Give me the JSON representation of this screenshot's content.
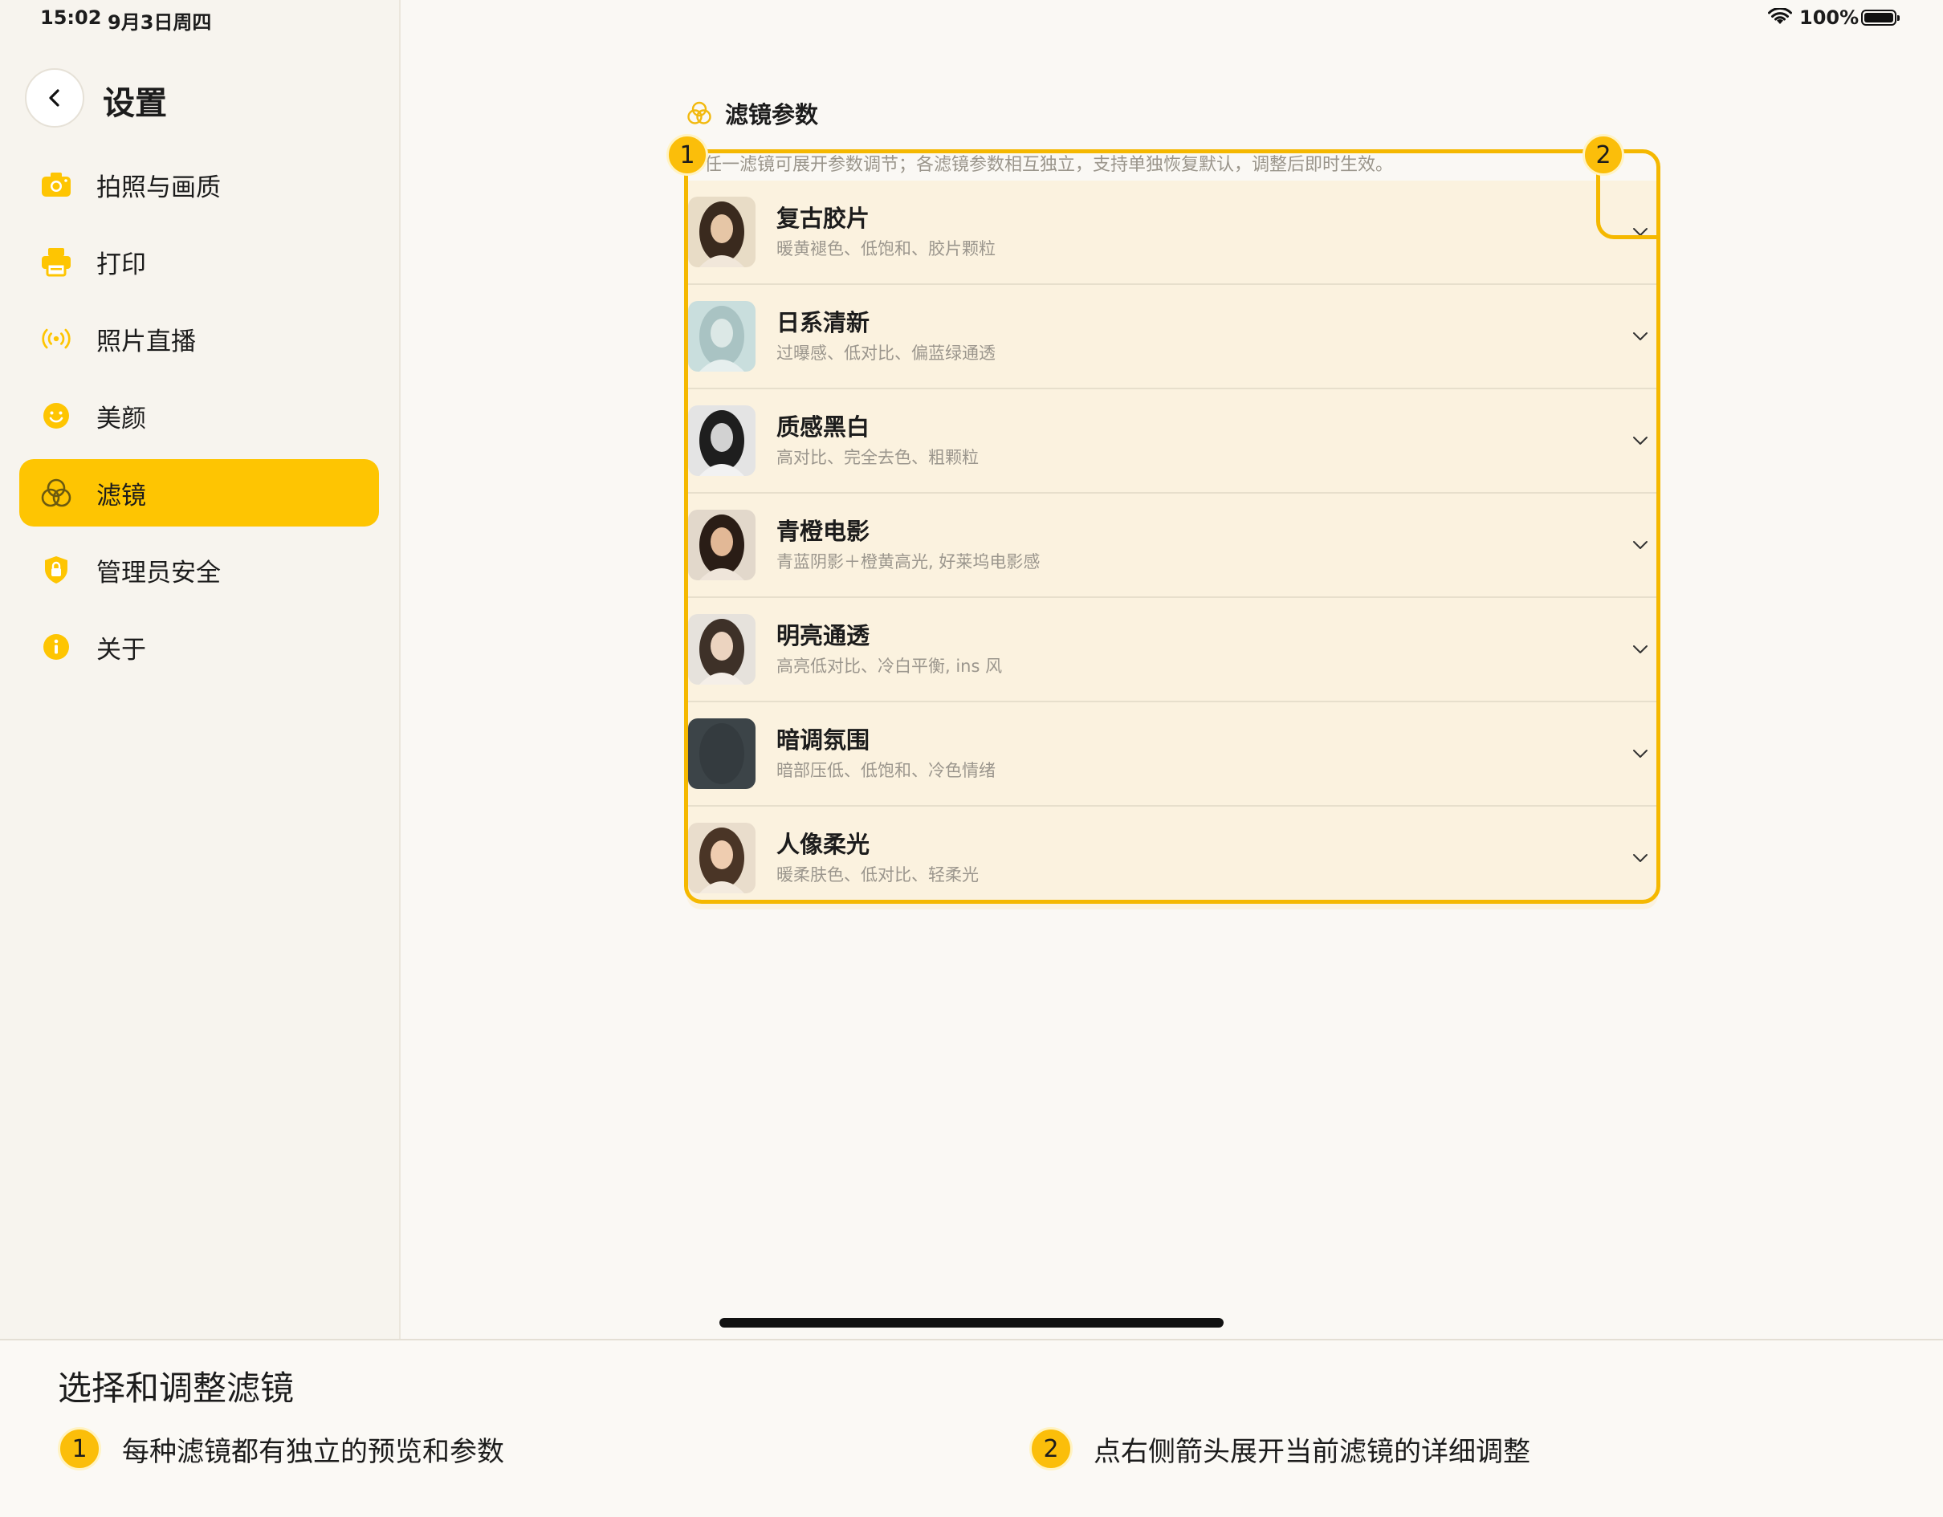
{
  "status": {
    "time": "15:02",
    "date": "9月3日周四",
    "battery": "100%"
  },
  "sidebar": {
    "title": "设置",
    "items": [
      {
        "label": "拍照与画质",
        "icon": "camera-icon",
        "active": false
      },
      {
        "label": "打印",
        "icon": "printer-icon",
        "active": false
      },
      {
        "label": "照片直播",
        "icon": "broadcast-icon",
        "active": false
      },
      {
        "label": "美颜",
        "icon": "smile-icon",
        "active": false
      },
      {
        "label": "滤镜",
        "icon": "filter-icon",
        "active": true
      },
      {
        "label": "管理员安全",
        "icon": "shield-lock-icon",
        "active": false
      },
      {
        "label": "关于",
        "icon": "info-icon",
        "active": false
      }
    ]
  },
  "main": {
    "section_title": "滤镜参数",
    "hint": "择任一滤镜可展开参数调节；各滤镜参数相互独立，支持单独恢复默认，调整后即时生效。",
    "filters": [
      {
        "name": "复古胶片",
        "desc": "暖黄褪色、低饱和、胶片颗粒"
      },
      {
        "name": "日系清新",
        "desc": "过曝感、低对比、偏蓝绿通透"
      },
      {
        "name": "质感黑白",
        "desc": "高对比、完全去色、粗颗粒"
      },
      {
        "name": "青橙电影",
        "desc": "青蓝阴影＋橙黄高光, 好莱坞电影感"
      },
      {
        "name": "明亮通透",
        "desc": "高亮低对比、冷白平衡, ins 风"
      },
      {
        "name": "暗调氛围",
        "desc": "暗部压低、低饱和、冷色情绪"
      },
      {
        "name": "人像柔光",
        "desc": "暖柔肤色、低对比、轻柔光"
      }
    ]
  },
  "annotations": {
    "badge1": "1",
    "badge2": "2",
    "caption_title": "选择和调整滤镜",
    "items": [
      {
        "number": "1",
        "text": "每种滤镜都有独立的预览和参数"
      },
      {
        "number": "2",
        "text": "点右侧箭头展开当前滤镜的详细调整"
      }
    ]
  },
  "colors": {
    "accent": "#fec502",
    "highlight": "#f5b800",
    "list_bg": "#fbf2df"
  }
}
